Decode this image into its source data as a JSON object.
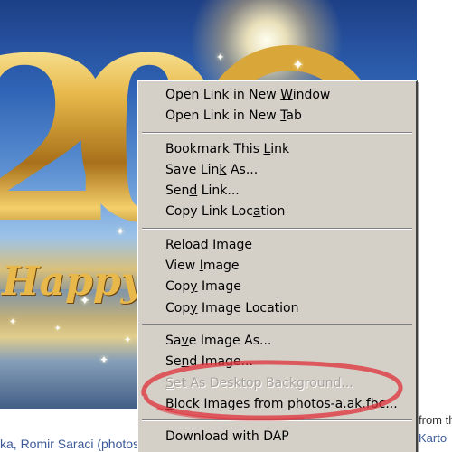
{
  "background": {
    "image_text": "Happy",
    "caption_left": "ka, Romir Saraci (photos",
    "caption_right_line1": "from th",
    "caption_right_line2": "Karto"
  },
  "context_menu": {
    "groups": [
      [
        {
          "pre": "Open Link in New ",
          "mn": "W",
          "post": "indow",
          "enabled": true
        },
        {
          "pre": "Open Link in New ",
          "mn": "T",
          "post": "ab",
          "enabled": true
        }
      ],
      [
        {
          "pre": "Bookmark This ",
          "mn": "L",
          "post": "ink",
          "enabled": true
        },
        {
          "pre": "Save Lin",
          "mn": "k",
          "post": " As...",
          "enabled": true
        },
        {
          "pre": "Sen",
          "mn": "d",
          "post": " Link...",
          "enabled": true
        },
        {
          "pre": "Copy Link Loc",
          "mn": "a",
          "post": "tion",
          "enabled": true
        }
      ],
      [
        {
          "pre": "",
          "mn": "R",
          "post": "eload Image",
          "enabled": true
        },
        {
          "pre": "View ",
          "mn": "I",
          "post": "mage",
          "enabled": true
        },
        {
          "pre": "Cop",
          "mn": "y",
          "post": " Image",
          "enabled": true
        },
        {
          "pre": "Cop",
          "mn": "y",
          "post": " Image Location",
          "enabled": true
        }
      ],
      [
        {
          "pre": "Sa",
          "mn": "v",
          "post": "e Image As...",
          "enabled": true
        },
        {
          "pre": "Se",
          "mn": "n",
          "post": "d Image...",
          "enabled": true
        },
        {
          "pre": "",
          "mn": "S",
          "post": "et As Desktop Background...",
          "enabled": false
        },
        {
          "pre": "",
          "mn": "B",
          "post": "lock Images from photos-a.ak.fbc...",
          "enabled": true
        }
      ],
      [
        {
          "pre": "Download with DAP",
          "mn": "",
          "post": "",
          "enabled": true
        }
      ]
    ]
  },
  "colors": {
    "menu_bg": "#d4d0c8",
    "disabled_text": "#a7a39b",
    "highlight_ellipse": "#e0303a",
    "link": "#3b5998"
  },
  "icons": {
    "sparkle": "sparkle-icon"
  }
}
